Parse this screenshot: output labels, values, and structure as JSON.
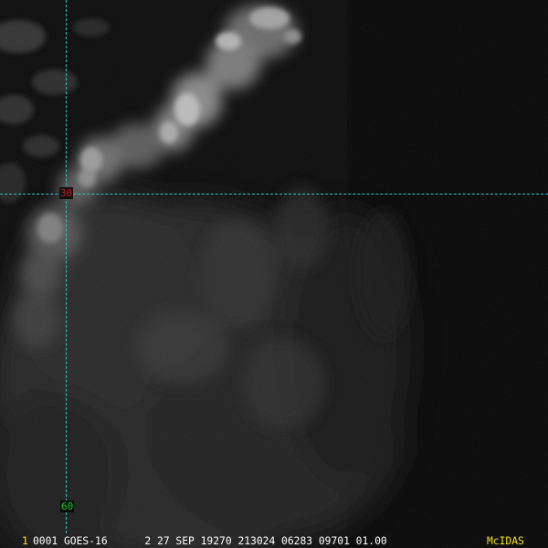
{
  "colors": {
    "grid_line": "#2bc3c8",
    "latitude_label": "#d01818",
    "longitude_label": "#20d020",
    "frame_number": "#f4e21a",
    "header_text": "#ffffff",
    "brand": "#f4e21a"
  },
  "grid": {
    "latitude_label": "30",
    "longitude_label": "60"
  },
  "status_bar": {
    "frame_number": "1",
    "header": "0001 GOES-16      2 27 SEP 19270 213024 06283 09701 01.00",
    "brand": "McIDAS"
  }
}
